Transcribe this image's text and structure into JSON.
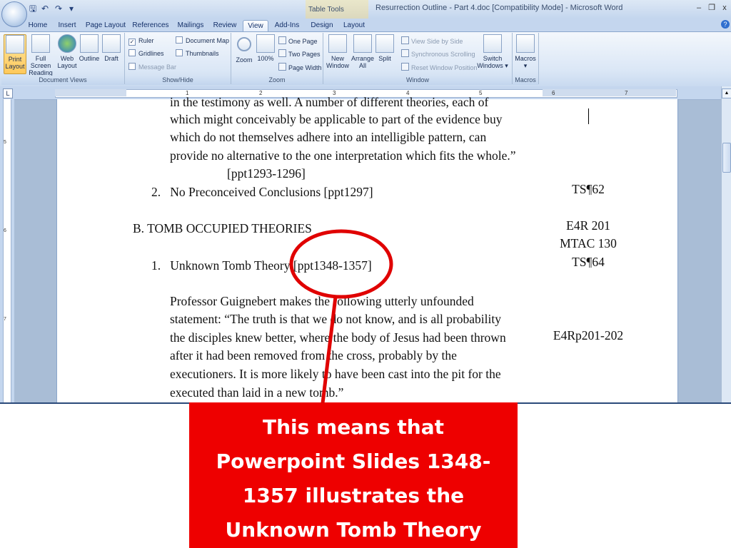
{
  "window": {
    "title": "Resurrection Outline - Part 4.doc [Compatibility Mode] - Microsoft Word",
    "context_tab_label": "Table Tools",
    "controls": {
      "minimize": "–",
      "restore": "❐",
      "close": "x"
    }
  },
  "qat": {
    "save": "🖫",
    "undo": "↶",
    "redo": "↷",
    "more": "▾"
  },
  "tabs": [
    {
      "label": "Home"
    },
    {
      "label": "Insert"
    },
    {
      "label": "Page Layout"
    },
    {
      "label": "References"
    },
    {
      "label": "Mailings"
    },
    {
      "label": "Review"
    },
    {
      "label": "View",
      "active": true
    },
    {
      "label": "Add-Ins"
    },
    {
      "label": "Design"
    },
    {
      "label": "Layout"
    }
  ],
  "ribbon": {
    "document_views": {
      "label": "Document Views",
      "print_layout": [
        "Print",
        "Layout"
      ],
      "full_screen": [
        "Full Screen",
        "Reading"
      ],
      "web_layout": [
        "Web",
        "Layout"
      ],
      "outline": "Outline",
      "draft": "Draft"
    },
    "show_hide": {
      "label": "Show/Hide",
      "ruler": "Ruler",
      "gridlines": "Gridlines",
      "message_bar": "Message Bar",
      "document_map": "Document Map",
      "thumbnails": "Thumbnails",
      "ruler_checked": "✓"
    },
    "zoom": {
      "label": "Zoom",
      "zoom": "Zoom",
      "hundred": "100%",
      "one_page": "One Page",
      "two_pages": "Two Pages",
      "page_width": "Page Width"
    },
    "window": {
      "label": "Window",
      "new_window": [
        "New",
        "Window"
      ],
      "arrange_all": [
        "Arrange",
        "All"
      ],
      "split": "Split",
      "view_side_by_side": "View Side by Side",
      "sync_scrolling": "Synchronous Scrolling",
      "reset_window": "Reset Window Position",
      "switch_windows": [
        "Switch",
        "Windows ▾"
      ]
    },
    "macros": {
      "label": "Macros",
      "button": "Macros",
      "arrow": "▾"
    }
  },
  "ruler": {
    "numbers": [
      "1",
      "2",
      "3",
      "4",
      "5",
      "6",
      "7"
    ],
    "corner": "L",
    "vertical_numbers": [
      "5",
      "6",
      "7"
    ]
  },
  "document": {
    "lines": [
      "in the testimony as well.  A number of different theories, each of",
      "which might conceivably be applicable to part of the evidence buy",
      "which do not themselves adhere into an intelligible pattern, can",
      "provide no alternative to the one interpretation which fits the whole.”",
      "[ppt1293-1296]",
      "2.   No Preconceived Conclusions [ppt1297]",
      "B.  TOMB OCCUPIED THEORIES",
      "1.   Unknown Tomb Theory [ppt1348-1357]",
      "Professor Guignebert makes the following utterly unfounded",
      "statement: “The truth is that we do not know, and is all probability",
      "the disciples knew better, where the body of Jesus had been thrown",
      "after it had been removed from the cross, probably by the",
      "executioners.  It is more likely to have been cast into the pit for the",
      "executed than laid in a new tomb.”"
    ],
    "references": [
      "TS¶62",
      "E4R 201",
      "MTAC 130",
      "TS¶64",
      "E4Rp201-202"
    ]
  },
  "callout": {
    "text": "This means that Powerpoint Slides 1348-1357 illustrates the Unknown Tomb Theory",
    "lines": [
      "This means that",
      "Powerpoint Slides 1348-",
      "1357 illustrates the",
      "Unknown Tomb Theory"
    ],
    "box_color": "#ee0000",
    "annotation_color": "#e00000"
  }
}
